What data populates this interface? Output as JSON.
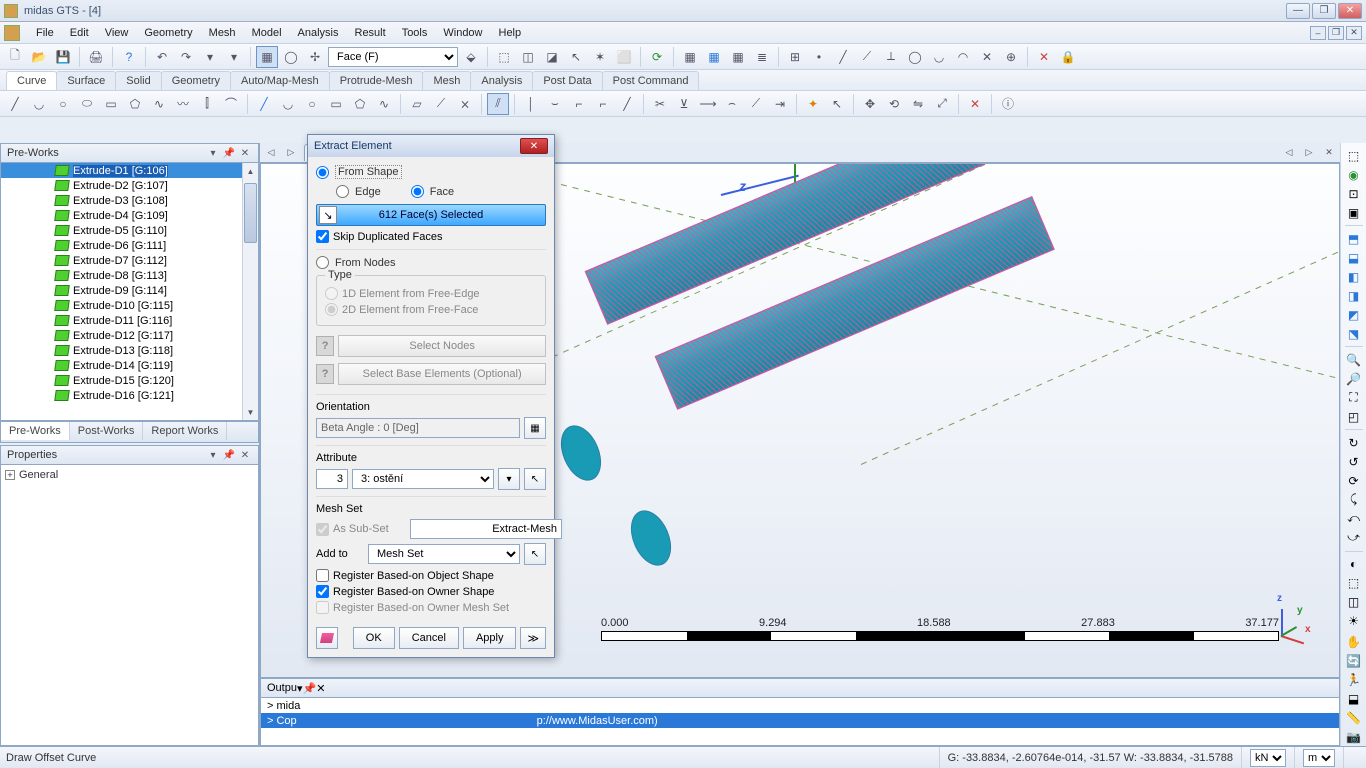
{
  "title": "midas GTS - [4]",
  "menu": [
    "File",
    "Edit",
    "View",
    "Geometry",
    "Mesh",
    "Model",
    "Analysis",
    "Result",
    "Tools",
    "Window",
    "Help"
  ],
  "toolbar1": {
    "select_mode": "Face (F)"
  },
  "tabs": [
    "Curve",
    "Surface",
    "Solid",
    "Geometry",
    "Auto/Map-Mesh",
    "Protrude-Mesh",
    "Mesh",
    "Analysis",
    "Post Data",
    "Post Command"
  ],
  "active_tab": "Curve",
  "preworks": {
    "title": "Pre-Works",
    "items": [
      {
        "label": "Extrude-D1 [G:106]"
      },
      {
        "label": "Extrude-D2 [G:107]"
      },
      {
        "label": "Extrude-D3 [G:108]"
      },
      {
        "label": "Extrude-D4 [G:109]"
      },
      {
        "label": "Extrude-D5 [G:110]"
      },
      {
        "label": "Extrude-D6 [G:111]"
      },
      {
        "label": "Extrude-D7 [G:112]"
      },
      {
        "label": "Extrude-D8 [G:113]"
      },
      {
        "label": "Extrude-D9 [G:114]"
      },
      {
        "label": "Extrude-D10 [G:115]"
      },
      {
        "label": "Extrude-D11 [G:116]"
      },
      {
        "label": "Extrude-D12 [G:117]"
      },
      {
        "label": "Extrude-D13 [G:118]"
      },
      {
        "label": "Extrude-D14 [G:119]"
      },
      {
        "label": "Extrude-D15 [G:120]"
      },
      {
        "label": "Extrude-D16 [G:121]"
      }
    ],
    "bottom_tabs": [
      "Pre-Works",
      "Post-Works",
      "Report Works"
    ]
  },
  "properties": {
    "title": "Properties",
    "general": "General"
  },
  "doc_tab": "4",
  "axes": {
    "x": "x",
    "z": "z"
  },
  "scalebar": {
    "ticks": [
      "0.000",
      "9.294",
      "18.588",
      "27.883",
      "37.177"
    ]
  },
  "gnomon": {
    "x": "x",
    "y": "y",
    "z": "z"
  },
  "output": {
    "title": "Outpu",
    "lines": [
      "> mida",
      "> Cop"
    ],
    "url": "p://www.MidasUser.com)"
  },
  "statusbar": {
    "hint": "Draw Offset Curve",
    "coords": "G: -33.8834, -2.60764e-014, -31.57   W: -33.8834, -31.5788",
    "unit1": "kN",
    "unit2": "m"
  },
  "dialog": {
    "title": "Extract Element",
    "from_shape": "From Shape",
    "edge": "Edge",
    "face": "Face",
    "selected": "612 Face(s) Selected",
    "skip_dup": "Skip Duplicated Faces",
    "from_nodes": "From Nodes",
    "type": "Type",
    "type_1d": "1D Element from Free-Edge",
    "type_2d": "2D Element from Free-Face",
    "select_nodes": "Select Nodes",
    "select_base": "Select Base Elements (Optional)",
    "orientation": "Orientation",
    "beta": "Beta Angle : 0 [Deg]",
    "attribute": "Attribute",
    "attr_num": "3",
    "attr_sel": "3: ostění",
    "mesh_set": "Mesh Set",
    "as_subset": "As Sub-Set",
    "extract_mesh": "Extract-Mesh",
    "add_to": "Add to",
    "add_to_sel": "Mesh Set",
    "reg_obj": "Register Based-on Object Shape",
    "reg_owner": "Register Based-on Owner Shape",
    "reg_owner_ms": "Register Based-on Owner Mesh Set",
    "ok": "OK",
    "cancel": "Cancel",
    "apply": "Apply",
    "more": "≫"
  }
}
